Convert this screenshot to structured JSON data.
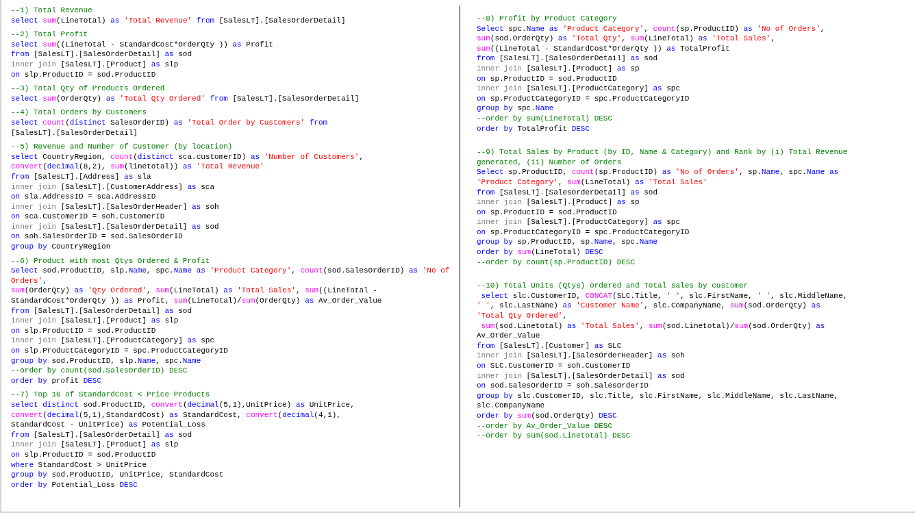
{
  "columns": [
    {
      "blocks": [
        {
          "lines": [
            [
              {
                "kind": "comment",
                "text": "--1) Total Revenue"
              }
            ],
            [
              {
                "kind": "keyword",
                "text": "select "
              },
              {
                "kind": "function",
                "text": "sum"
              },
              {
                "kind": "plain",
                "text": "(LineTotal) "
              },
              {
                "kind": "keyword",
                "text": "as "
              },
              {
                "kind": "string",
                "text": "'Total Revenue' "
              },
              {
                "kind": "keyword",
                "text": "from"
              },
              {
                "kind": "plain",
                "text": " [SalesLT].[SalesOrderDetail]"
              }
            ]
          ]
        },
        {
          "lines": [
            [
              {
                "kind": "comment",
                "text": "--2) Total Profit"
              }
            ],
            [
              {
                "kind": "keyword",
                "text": "select "
              },
              {
                "kind": "function",
                "text": "sum"
              },
              {
                "kind": "plain",
                "text": "((LineTotal - StandardCost*OrderQty )) "
              },
              {
                "kind": "keyword",
                "text": "as"
              },
              {
                "kind": "plain",
                "text": " Profit"
              }
            ],
            [
              {
                "kind": "keyword",
                "text": "from"
              },
              {
                "kind": "plain",
                "text": " [SalesLT].[SalesOrderDetail] "
              },
              {
                "kind": "keyword",
                "text": "as"
              },
              {
                "kind": "plain",
                "text": " sod"
              }
            ],
            [
              {
                "kind": "join",
                "text": "inner join"
              },
              {
                "kind": "plain",
                "text": " [SalesLT].[Product] "
              },
              {
                "kind": "keyword",
                "text": "as"
              },
              {
                "kind": "plain",
                "text": " slp"
              }
            ],
            [
              {
                "kind": "keyword",
                "text": "on"
              },
              {
                "kind": "plain",
                "text": " slp.ProductID = sod.ProductID"
              }
            ]
          ]
        },
        {
          "lines": [
            [
              {
                "kind": "comment",
                "text": "--3) Total Qty of Products Ordered"
              }
            ],
            [
              {
                "kind": "keyword",
                "text": "select "
              },
              {
                "kind": "function",
                "text": "sum"
              },
              {
                "kind": "plain",
                "text": "(OrderQty) "
              },
              {
                "kind": "keyword",
                "text": "as "
              },
              {
                "kind": "string",
                "text": "'Total Qty Ordered' "
              },
              {
                "kind": "keyword",
                "text": "from"
              },
              {
                "kind": "plain",
                "text": " [SalesLT].[SalesOrderDetail]"
              }
            ]
          ]
        },
        {
          "lines": [
            [
              {
                "kind": "comment",
                "text": "--4) Total Orders by Customers"
              }
            ],
            [
              {
                "kind": "keyword",
                "text": "select "
              },
              {
                "kind": "function",
                "text": "count"
              },
              {
                "kind": "plain",
                "text": "("
              },
              {
                "kind": "keyword",
                "text": "distinct"
              },
              {
                "kind": "plain",
                "text": " SalesOrderID) "
              },
              {
                "kind": "keyword",
                "text": "as "
              },
              {
                "kind": "string",
                "text": "'Total Order by Customers' "
              },
              {
                "kind": "keyword",
                "text": "from"
              }
            ],
            [
              {
                "kind": "plain",
                "text": "[SalesLT].[SalesOrderDetail]"
              }
            ]
          ]
        },
        {
          "lines": [
            [
              {
                "kind": "comment",
                "text": "--5) Revenue and Number of Customer (by location)"
              }
            ],
            [
              {
                "kind": "keyword",
                "text": "select"
              },
              {
                "kind": "plain",
                "text": " CountryRegion, "
              },
              {
                "kind": "function",
                "text": "count"
              },
              {
                "kind": "plain",
                "text": "("
              },
              {
                "kind": "keyword",
                "text": "distinct"
              },
              {
                "kind": "plain",
                "text": " sca.customerID) "
              },
              {
                "kind": "keyword",
                "text": "as "
              },
              {
                "kind": "string",
                "text": "'Number of Customers'"
              },
              {
                "kind": "plain",
                "text": ","
              }
            ],
            [
              {
                "kind": "function",
                "text": "convert"
              },
              {
                "kind": "plain",
                "text": "("
              },
              {
                "kind": "keyword",
                "text": "decimal"
              },
              {
                "kind": "plain",
                "text": "(8,2), "
              },
              {
                "kind": "function",
                "text": "sum"
              },
              {
                "kind": "plain",
                "text": "(linetotal)) "
              },
              {
                "kind": "keyword",
                "text": "as "
              },
              {
                "kind": "string",
                "text": "'Total Revenue'"
              }
            ],
            [
              {
                "kind": "keyword",
                "text": "from"
              },
              {
                "kind": "plain",
                "text": " [SalesLT].[Address] "
              },
              {
                "kind": "keyword",
                "text": "as"
              },
              {
                "kind": "plain",
                "text": " sla"
              }
            ],
            [
              {
                "kind": "join",
                "text": "inner join"
              },
              {
                "kind": "plain",
                "text": " [SalesLT].[CustomerAddress] "
              },
              {
                "kind": "keyword",
                "text": "as"
              },
              {
                "kind": "plain",
                "text": " sca"
              }
            ],
            [
              {
                "kind": "keyword",
                "text": "on"
              },
              {
                "kind": "plain",
                "text": " sla.AddressID = sca.AddressID"
              }
            ],
            [
              {
                "kind": "join",
                "text": "inner join"
              },
              {
                "kind": "plain",
                "text": " [SalesLT].[SalesOrderHeader] "
              },
              {
                "kind": "keyword",
                "text": "as"
              },
              {
                "kind": "plain",
                "text": " soh"
              }
            ],
            [
              {
                "kind": "keyword",
                "text": "on"
              },
              {
                "kind": "plain",
                "text": " sca.CustomerID = soh.CustomerID"
              }
            ],
            [
              {
                "kind": "join",
                "text": "inner join"
              },
              {
                "kind": "plain",
                "text": " [SalesLT].[SalesOrderDetail] "
              },
              {
                "kind": "keyword",
                "text": "as"
              },
              {
                "kind": "plain",
                "text": " sod"
              }
            ],
            [
              {
                "kind": "keyword",
                "text": "on"
              },
              {
                "kind": "plain",
                "text": " soh.SalesOrderID = sod.SalesOrderID"
              }
            ],
            [
              {
                "kind": "keyword",
                "text": "group by"
              },
              {
                "kind": "plain",
                "text": " CountryRegion"
              }
            ]
          ]
        },
        {
          "lines": [
            [
              {
                "kind": "comment",
                "text": "--6) Product with most Qtys Ordered & Profit"
              }
            ],
            [
              {
                "kind": "keyword",
                "text": "Select"
              },
              {
                "kind": "plain",
                "text": " sod.ProductID, slp."
              },
              {
                "kind": "keyword",
                "text": "Name"
              },
              {
                "kind": "plain",
                "text": ", spc."
              },
              {
                "kind": "keyword",
                "text": "Name as "
              },
              {
                "kind": "string",
                "text": "'Product Category'"
              },
              {
                "kind": "plain",
                "text": ", "
              },
              {
                "kind": "function",
                "text": "count"
              },
              {
                "kind": "plain",
                "text": "(sod.SalesOrderID) "
              },
              {
                "kind": "keyword",
                "text": "as "
              },
              {
                "kind": "string",
                "text": "'No of"
              }
            ],
            [
              {
                "kind": "string",
                "text": "Orders'"
              },
              {
                "kind": "plain",
                "text": ","
              }
            ],
            [
              {
                "kind": "function",
                "text": "sum"
              },
              {
                "kind": "plain",
                "text": "(OrderQty) "
              },
              {
                "kind": "keyword",
                "text": "as "
              },
              {
                "kind": "string",
                "text": "'Qty Ordered'"
              },
              {
                "kind": "plain",
                "text": ", "
              },
              {
                "kind": "function",
                "text": "sum"
              },
              {
                "kind": "plain",
                "text": "(LineTotal) "
              },
              {
                "kind": "keyword",
                "text": "as "
              },
              {
                "kind": "string",
                "text": "'Total Sales'"
              },
              {
                "kind": "plain",
                "text": ", "
              },
              {
                "kind": "function",
                "text": "sum"
              },
              {
                "kind": "plain",
                "text": "((LineTotal -"
              }
            ],
            [
              {
                "kind": "plain",
                "text": "StandardCost*OrderQty )) "
              },
              {
                "kind": "keyword",
                "text": "as"
              },
              {
                "kind": "plain",
                "text": " Profit, "
              },
              {
                "kind": "function",
                "text": "sum"
              },
              {
                "kind": "plain",
                "text": "(LineTotal)/"
              },
              {
                "kind": "function",
                "text": "sum"
              },
              {
                "kind": "plain",
                "text": "(OrderQty) "
              },
              {
                "kind": "keyword",
                "text": "as"
              },
              {
                "kind": "plain",
                "text": " Av_Order_Value"
              }
            ],
            [
              {
                "kind": "keyword",
                "text": "from"
              },
              {
                "kind": "plain",
                "text": " [SalesLT].[SalesOrderDetail] "
              },
              {
                "kind": "keyword",
                "text": "as"
              },
              {
                "kind": "plain",
                "text": " sod"
              }
            ],
            [
              {
                "kind": "join",
                "text": "inner join"
              },
              {
                "kind": "plain",
                "text": " [SalesLT].[Product] "
              },
              {
                "kind": "keyword",
                "text": "as"
              },
              {
                "kind": "plain",
                "text": " slp"
              }
            ],
            [
              {
                "kind": "keyword",
                "text": "on"
              },
              {
                "kind": "plain",
                "text": " slp.ProductID = sod.ProductID"
              }
            ],
            [
              {
                "kind": "join",
                "text": "inner join"
              },
              {
                "kind": "plain",
                "text": " [SalesLT].[ProductCategory] "
              },
              {
                "kind": "keyword",
                "text": "as"
              },
              {
                "kind": "plain",
                "text": " spc"
              }
            ],
            [
              {
                "kind": "keyword",
                "text": "on"
              },
              {
                "kind": "plain",
                "text": " slp.ProductCategoryID = spc.ProductCategoryID"
              }
            ],
            [
              {
                "kind": "keyword",
                "text": "group by"
              },
              {
                "kind": "plain",
                "text": " sod.ProductID, slp."
              },
              {
                "kind": "keyword",
                "text": "Name"
              },
              {
                "kind": "plain",
                "text": ", spc."
              },
              {
                "kind": "keyword",
                "text": "Name"
              }
            ],
            [
              {
                "kind": "comment",
                "text": "--order by count(sod.SalesOrderID) DESC"
              }
            ],
            [
              {
                "kind": "keyword",
                "text": "order by"
              },
              {
                "kind": "plain",
                "text": " profit "
              },
              {
                "kind": "keyword",
                "text": "DESC"
              }
            ]
          ]
        },
        {
          "lines": [
            [
              {
                "kind": "comment",
                "text": "--7) Top 10 of StandardCost < Price Products"
              }
            ],
            [
              {
                "kind": "keyword",
                "text": "select distinct"
              },
              {
                "kind": "plain",
                "text": " sod.ProductID, "
              },
              {
                "kind": "function",
                "text": "convert"
              },
              {
                "kind": "plain",
                "text": "("
              },
              {
                "kind": "keyword",
                "text": "decimal"
              },
              {
                "kind": "plain",
                "text": "(5,1),UnitPrice) "
              },
              {
                "kind": "keyword",
                "text": "as"
              },
              {
                "kind": "plain",
                "text": " UnitPrice,"
              }
            ],
            [
              {
                "kind": "function",
                "text": "convert"
              },
              {
                "kind": "plain",
                "text": "("
              },
              {
                "kind": "keyword",
                "text": "decimal"
              },
              {
                "kind": "plain",
                "text": "(5,1),StandardCost) "
              },
              {
                "kind": "keyword",
                "text": "as"
              },
              {
                "kind": "plain",
                "text": " StandardCost, "
              },
              {
                "kind": "function",
                "text": "convert"
              },
              {
                "kind": "plain",
                "text": "("
              },
              {
                "kind": "keyword",
                "text": "decimal"
              },
              {
                "kind": "plain",
                "text": "(4,1),"
              }
            ],
            [
              {
                "kind": "plain",
                "text": "StandardCost - UnitPrice) "
              },
              {
                "kind": "keyword",
                "text": "as"
              },
              {
                "kind": "plain",
                "text": " Potential_Loss"
              }
            ],
            [
              {
                "kind": "keyword",
                "text": "from"
              },
              {
                "kind": "plain",
                "text": " [SalesLT].[SalesOrderDetail] "
              },
              {
                "kind": "keyword",
                "text": "as"
              },
              {
                "kind": "plain",
                "text": " sod"
              }
            ],
            [
              {
                "kind": "join",
                "text": "inner join"
              },
              {
                "kind": "plain",
                "text": " [SalesLT].[Product] "
              },
              {
                "kind": "keyword",
                "text": "as"
              },
              {
                "kind": "plain",
                "text": " slp"
              }
            ],
            [
              {
                "kind": "keyword",
                "text": "on"
              },
              {
                "kind": "plain",
                "text": " slp.ProductID = sod.ProductID"
              }
            ],
            [
              {
                "kind": "keyword",
                "text": "where"
              },
              {
                "kind": "plain",
                "text": " StandardCost > UnitPrice"
              }
            ],
            [
              {
                "kind": "keyword",
                "text": "group by"
              },
              {
                "kind": "plain",
                "text": " sod.ProductID, UnitPrice, StandardCost"
              }
            ],
            [
              {
                "kind": "keyword",
                "text": "order by"
              },
              {
                "kind": "plain",
                "text": " Potential_Loss "
              },
              {
                "kind": "keyword",
                "text": "DESC"
              }
            ]
          ]
        }
      ]
    },
    {
      "blocks": [
        {
          "lines": [
            [
              {
                "kind": "comment",
                "text": "--8) Profit by Product Category"
              }
            ],
            [
              {
                "kind": "keyword",
                "text": "Select"
              },
              {
                "kind": "plain",
                "text": " spc."
              },
              {
                "kind": "keyword",
                "text": "Name as "
              },
              {
                "kind": "string",
                "text": "'Product Category'"
              },
              {
                "kind": "plain",
                "text": ", "
              },
              {
                "kind": "function",
                "text": "count"
              },
              {
                "kind": "plain",
                "text": "(sp.ProductID) "
              },
              {
                "kind": "keyword",
                "text": "as "
              },
              {
                "kind": "string",
                "text": "'No of Orders'"
              },
              {
                "kind": "plain",
                "text": ","
              }
            ],
            [
              {
                "kind": "function",
                "text": "sum"
              },
              {
                "kind": "plain",
                "text": "(sod.OrderQty) "
              },
              {
                "kind": "keyword",
                "text": "as "
              },
              {
                "kind": "string",
                "text": "'Total Qty'"
              },
              {
                "kind": "plain",
                "text": ", "
              },
              {
                "kind": "function",
                "text": "sum"
              },
              {
                "kind": "plain",
                "text": "(LineTotal) "
              },
              {
                "kind": "keyword",
                "text": "as "
              },
              {
                "kind": "string",
                "text": "'Total Sales'"
              },
              {
                "kind": "plain",
                "text": ","
              }
            ],
            [
              {
                "kind": "function",
                "text": "sum"
              },
              {
                "kind": "plain",
                "text": "((LineTotal - StandardCost*OrderQty )) "
              },
              {
                "kind": "keyword",
                "text": "as"
              },
              {
                "kind": "plain",
                "text": " TotalProfit"
              }
            ],
            [
              {
                "kind": "keyword",
                "text": "from"
              },
              {
                "kind": "plain",
                "text": " [SalesLT].[SalesOrderDetail] "
              },
              {
                "kind": "keyword",
                "text": "as"
              },
              {
                "kind": "plain",
                "text": " sod"
              }
            ],
            [
              {
                "kind": "join",
                "text": "inner join"
              },
              {
                "kind": "plain",
                "text": " [SalesLT].[Product] "
              },
              {
                "kind": "keyword",
                "text": "as"
              },
              {
                "kind": "plain",
                "text": " sp"
              }
            ],
            [
              {
                "kind": "keyword",
                "text": "on"
              },
              {
                "kind": "plain",
                "text": " sp.ProductID = sod.ProductID"
              }
            ],
            [
              {
                "kind": "join",
                "text": "inner join"
              },
              {
                "kind": "plain",
                "text": " [SalesLT].[ProductCategory] "
              },
              {
                "kind": "keyword",
                "text": "as"
              },
              {
                "kind": "plain",
                "text": " spc"
              }
            ],
            [
              {
                "kind": "keyword",
                "text": "on"
              },
              {
                "kind": "plain",
                "text": " sp.ProductCategoryID = spc.ProductCategoryID"
              }
            ],
            [
              {
                "kind": "keyword",
                "text": "group by"
              },
              {
                "kind": "plain",
                "text": " spc."
              },
              {
                "kind": "keyword",
                "text": "Name"
              }
            ],
            [
              {
                "kind": "comment",
                "text": "--order by sum(LineTotal) DESC"
              }
            ],
            [
              {
                "kind": "keyword",
                "text": "order by"
              },
              {
                "kind": "plain",
                "text": " TotalProfit "
              },
              {
                "kind": "keyword",
                "text": "DESC"
              }
            ]
          ]
        },
        {
          "lines": [
            [
              {
                "kind": "comment",
                "text": "--9) Total Sales by Product (by ID, Name & Category) and Rank by (i) Total Revenue"
              }
            ],
            [
              {
                "kind": "comment",
                "text": "generated, (ii) Number of Orders"
              }
            ],
            [
              {
                "kind": "keyword",
                "text": "Select"
              },
              {
                "kind": "plain",
                "text": " sp.ProductID, "
              },
              {
                "kind": "function",
                "text": "count"
              },
              {
                "kind": "plain",
                "text": "(sp.ProductID) "
              },
              {
                "kind": "keyword",
                "text": "as "
              },
              {
                "kind": "string",
                "text": "'No of Orders'"
              },
              {
                "kind": "plain",
                "text": ", sp."
              },
              {
                "kind": "keyword",
                "text": "Name"
              },
              {
                "kind": "plain",
                "text": ", spc."
              },
              {
                "kind": "keyword",
                "text": "Name as"
              }
            ],
            [
              {
                "kind": "string",
                "text": "'Product Category'"
              },
              {
                "kind": "plain",
                "text": ", "
              },
              {
                "kind": "function",
                "text": "sum"
              },
              {
                "kind": "plain",
                "text": "(LineTotal) "
              },
              {
                "kind": "keyword",
                "text": "as "
              },
              {
                "kind": "string",
                "text": "'Total Sales'"
              }
            ],
            [
              {
                "kind": "keyword",
                "text": "from"
              },
              {
                "kind": "plain",
                "text": " [SalesLT].[SalesOrderDetail] "
              },
              {
                "kind": "keyword",
                "text": "as"
              },
              {
                "kind": "plain",
                "text": " sod"
              }
            ],
            [
              {
                "kind": "join",
                "text": "inner join"
              },
              {
                "kind": "plain",
                "text": " [SalesLT].[Product] "
              },
              {
                "kind": "keyword",
                "text": "as"
              },
              {
                "kind": "plain",
                "text": " sp"
              }
            ],
            [
              {
                "kind": "keyword",
                "text": "on"
              },
              {
                "kind": "plain",
                "text": " sp.ProductID = sod.ProductID"
              }
            ],
            [
              {
                "kind": "join",
                "text": "inner join"
              },
              {
                "kind": "plain",
                "text": " [SalesLT].[ProductCategory] "
              },
              {
                "kind": "keyword",
                "text": "as"
              },
              {
                "kind": "plain",
                "text": " spc"
              }
            ],
            [
              {
                "kind": "keyword",
                "text": "on"
              },
              {
                "kind": "plain",
                "text": " sp.ProductCategoryID = spc.ProductCategoryID"
              }
            ],
            [
              {
                "kind": "keyword",
                "text": "group by"
              },
              {
                "kind": "plain",
                "text": " sp.ProductID, sp."
              },
              {
                "kind": "keyword",
                "text": "Name"
              },
              {
                "kind": "plain",
                "text": ", spc."
              },
              {
                "kind": "keyword",
                "text": "Name"
              }
            ],
            [
              {
                "kind": "keyword",
                "text": "order by "
              },
              {
                "kind": "function",
                "text": "sum"
              },
              {
                "kind": "plain",
                "text": "(LineTotal) "
              },
              {
                "kind": "keyword",
                "text": "DESC"
              }
            ],
            [
              {
                "kind": "comment",
                "text": "--order by count(sp.ProductID) DESC"
              }
            ]
          ]
        },
        {
          "lines": [
            [
              {
                "kind": "comment",
                "text": "--10) Total Units (Qtys) ordered and Total sales by customer"
              }
            ],
            [
              {
                "kind": "keyword",
                "text": " select"
              },
              {
                "kind": "plain",
                "text": " slc.CustomerID, "
              },
              {
                "kind": "function",
                "text": "CONCAT"
              },
              {
                "kind": "plain",
                "text": "(SLC.Title, "
              },
              {
                "kind": "string",
                "text": "' '"
              },
              {
                "kind": "plain",
                "text": ", slc.FirstName, "
              },
              {
                "kind": "string",
                "text": "' '"
              },
              {
                "kind": "plain",
                "text": ", slc.MiddleName,"
              }
            ],
            [
              {
                "kind": "string",
                "text": "' '"
              },
              {
                "kind": "plain",
                "text": ", slc.LastName) "
              },
              {
                "kind": "keyword",
                "text": "as "
              },
              {
                "kind": "string",
                "text": "'Customer Name'"
              },
              {
                "kind": "plain",
                "text": ", slc.CompanyName, "
              },
              {
                "kind": "function",
                "text": "sum"
              },
              {
                "kind": "plain",
                "text": "(sod.OrderQty) "
              },
              {
                "kind": "keyword",
                "text": "as"
              }
            ],
            [
              {
                "kind": "string",
                "text": "'Total Qty Ordered'"
              },
              {
                "kind": "plain",
                "text": ","
              }
            ],
            [
              {
                "kind": "function",
                "text": " sum"
              },
              {
                "kind": "plain",
                "text": "(sod.Linetotal) "
              },
              {
                "kind": "keyword",
                "text": "as "
              },
              {
                "kind": "string",
                "text": "'Total Sales'"
              },
              {
                "kind": "plain",
                "text": ", "
              },
              {
                "kind": "function",
                "text": "sum"
              },
              {
                "kind": "plain",
                "text": "(sod.Linetotal)/"
              },
              {
                "kind": "function",
                "text": "sum"
              },
              {
                "kind": "plain",
                "text": "(sod.OrderQty) "
              },
              {
                "kind": "keyword",
                "text": "as"
              }
            ],
            [
              {
                "kind": "plain",
                "text": "Av_Order_Value"
              }
            ],
            [
              {
                "kind": "keyword",
                "text": "from"
              },
              {
                "kind": "plain",
                "text": " [SalesLT].[Customer] "
              },
              {
                "kind": "keyword",
                "text": "as"
              },
              {
                "kind": "plain",
                "text": " SLC"
              }
            ],
            [
              {
                "kind": "join",
                "text": "inner join"
              },
              {
                "kind": "plain",
                "text": " [SalesLT].[SalesOrderHeader] "
              },
              {
                "kind": "keyword",
                "text": "as"
              },
              {
                "kind": "plain",
                "text": " soh"
              }
            ],
            [
              {
                "kind": "keyword",
                "text": "on"
              },
              {
                "kind": "plain",
                "text": " SLC.CustomerID = soh.CustomerID"
              }
            ],
            [
              {
                "kind": "join",
                "text": "inner join"
              },
              {
                "kind": "plain",
                "text": " [SalesLT].[SalesOrderDetail] "
              },
              {
                "kind": "keyword",
                "text": "as"
              },
              {
                "kind": "plain",
                "text": " sod"
              }
            ],
            [
              {
                "kind": "keyword",
                "text": "on"
              },
              {
                "kind": "plain",
                "text": " sod.SalesOrderID = soh.SalesOrderID"
              }
            ],
            [
              {
                "kind": "keyword",
                "text": "group by"
              },
              {
                "kind": "plain",
                "text": " slc.CustomerID, slc.Title, slc.FirstName, slc.MiddleName, slc.LastName,"
              }
            ],
            [
              {
                "kind": "plain",
                "text": "slc.CompanyName"
              }
            ],
            [
              {
                "kind": "keyword",
                "text": "order by "
              },
              {
                "kind": "function",
                "text": "sum"
              },
              {
                "kind": "plain",
                "text": "(sod.OrderQty) "
              },
              {
                "kind": "keyword",
                "text": "DESC"
              }
            ],
            [
              {
                "kind": "comment",
                "text": "--order by Av_Order_Value DESC"
              }
            ],
            [
              {
                "kind": "comment",
                "text": "--order by sum(sod.Linetotal) DESC"
              }
            ]
          ]
        }
      ]
    }
  ]
}
